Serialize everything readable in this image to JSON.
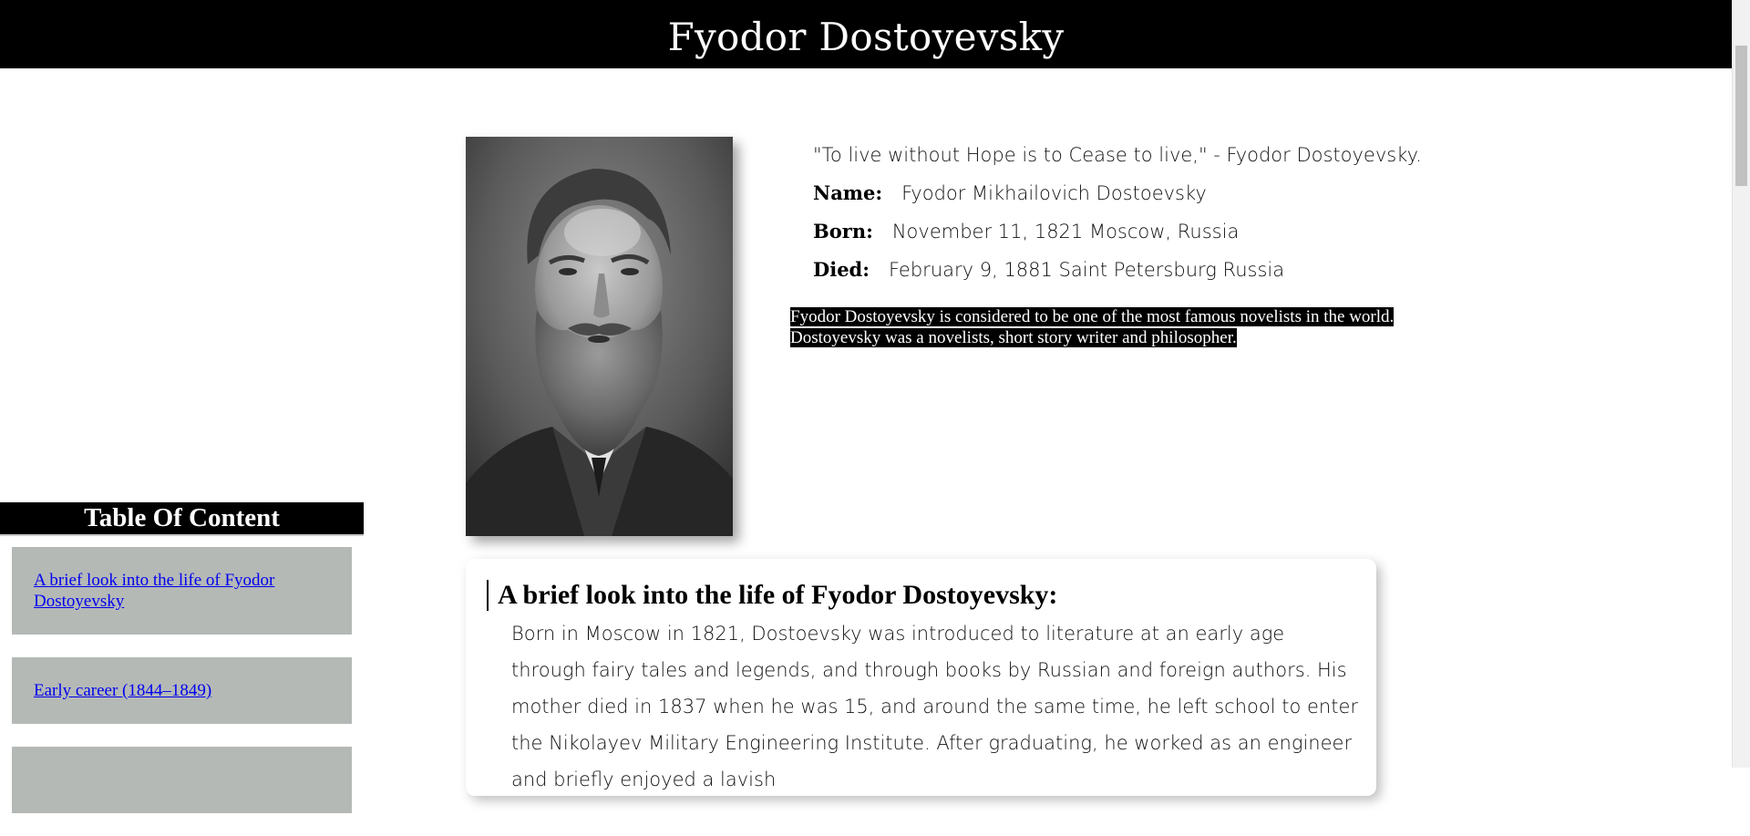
{
  "header": {
    "title": "Fyodor Dostoyevsky"
  },
  "portrait": {
    "alt": "Portrait of Fyodor Dostoyevsky"
  },
  "info": {
    "quote": "\"To live without Hope is to Cease to live,\" - Fyodor Dostoyevsky.",
    "facts": [
      {
        "label": "Name:",
        "value": "Fyodor Mikhailovich Dostoevsky"
      },
      {
        "label": "Born:",
        "value": "November 11, 1821 Moscow, Russia"
      },
      {
        "label": "Died:",
        "value": "February 9, 1881 Saint Petersburg Russia"
      }
    ],
    "summary": "Fyodor Dostoyevsky is considered to be one of the most famous novelists in the world. Dostoyevsky was a novelists, short story writer and philosopher."
  },
  "toc": {
    "title": "Table Of Content",
    "items": [
      {
        "label": "A brief look into the life of Fyodor Dostoyevsky"
      },
      {
        "label": "Early career (1844–1849)"
      },
      {
        "label": ""
      }
    ]
  },
  "bio": {
    "heading": "A brief look into the life of Fyodor Dostoyevsky:",
    "text": "Born in Moscow in 1821, Dostoevsky was introduced to literature at an early age through fairy tales and legends, and through books by Russian and foreign authors. His mother died in 1837 when he was 15, and around the same time, he left school to enter the Nikolayev Military Engineering Institute. After graduating, he worked as an engineer and briefly enjoyed a lavish"
  },
  "colors": {
    "header_bg": "#000000",
    "toc_item_bg": "#b5b9b6",
    "link": "#0000ee"
  }
}
